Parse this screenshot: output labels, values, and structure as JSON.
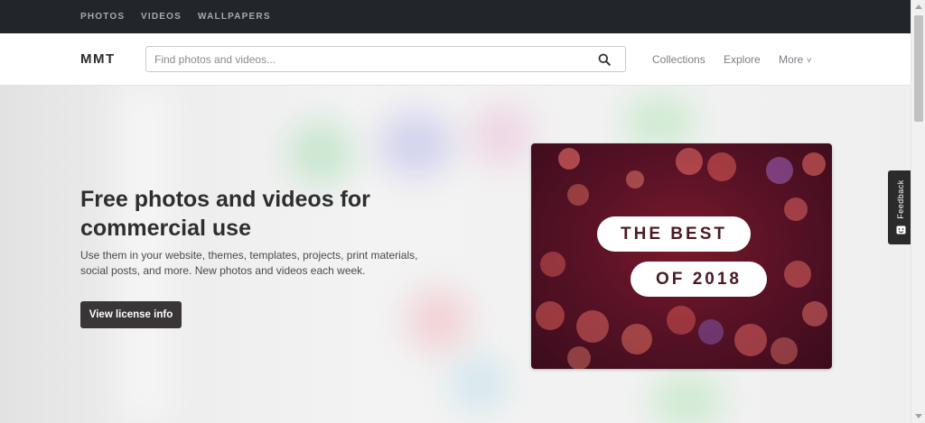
{
  "topbar": {
    "links": [
      "PHOTOS",
      "VIDEOS",
      "WALLPAPERS"
    ]
  },
  "header": {
    "logo": "MMT",
    "search_placeholder": "Find photos and videos...",
    "nav": {
      "collections": "Collections",
      "explore": "Explore",
      "more": "More",
      "more_chevron": "˅"
    }
  },
  "hero": {
    "title": "Free photos and videos for commercial use",
    "description": "Use them in your website, themes, templates, projects, print materials, social posts, and more. New photos and videos each week.",
    "button_label": "View license info"
  },
  "promo": {
    "line1": "THE BEST",
    "line2": "OF 2018"
  },
  "feedback": {
    "label": "Feedback"
  },
  "colors": {
    "topbar_bg": "#22252a",
    "button_bg": "#3a3638",
    "promo_bg": "#5a1226"
  },
  "icons": {
    "search": "search-icon",
    "feedback": "feedback-icon",
    "chevron": "chevron-down-icon"
  }
}
